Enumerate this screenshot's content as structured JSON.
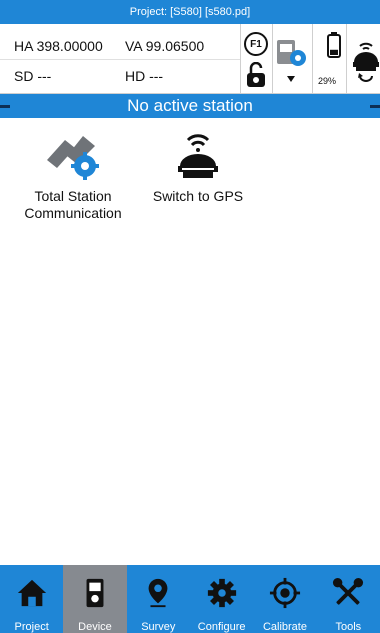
{
  "title_bar": "Project: [S580] [s580.pd]",
  "measurements": {
    "ha": "HA 398.00000",
    "va": "VA 99.06500",
    "sd": "SD ---",
    "hd": "HD ---"
  },
  "status": {
    "f1_label": "F1",
    "battery_percent": "29%",
    "battery_level": 0.29
  },
  "station_bar": "No active station",
  "apps": [
    {
      "label_line1": "Total Station",
      "label_line2": "Communication",
      "icon": "total-station-communication-icon"
    },
    {
      "label_line1": "Switch to GPS",
      "label_line2": "",
      "icon": "gps-receiver-icon"
    }
  ],
  "nav": [
    {
      "label": "Project",
      "icon": "home-icon"
    },
    {
      "label": "Device",
      "icon": "device-icon",
      "active": true
    },
    {
      "label": "Survey",
      "icon": "map-pin-icon"
    },
    {
      "label": "Configure",
      "icon": "gear-icon"
    },
    {
      "label": "Calibrate",
      "icon": "crosshair-icon"
    },
    {
      "label": "Tools",
      "icon": "tools-icon"
    }
  ],
  "colors": {
    "accent": "#1f86d6",
    "nav_active": "#868a90"
  }
}
